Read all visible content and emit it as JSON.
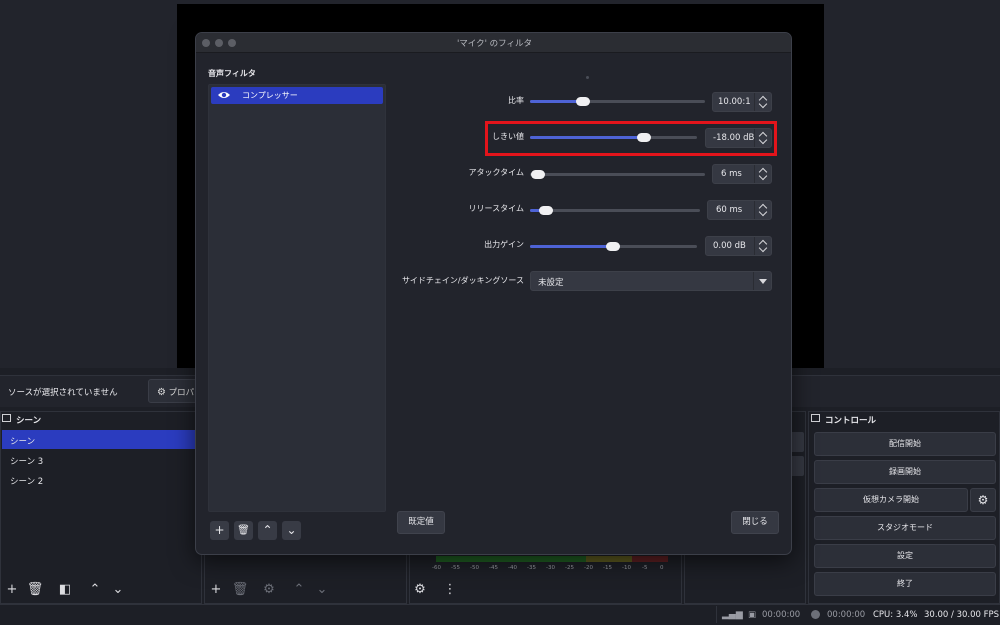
{
  "dialog": {
    "title": "'マイク' のフィルタ",
    "filters_label": "音声フィルタ",
    "filters": [
      {
        "label": "コンプレッサー",
        "icon": "eye-icon"
      }
    ],
    "default_button": "既定値",
    "close_button": "閉じる",
    "properties": {
      "ratio": {
        "label": "比率",
        "value": "10.00:1",
        "fill": 0.32
      },
      "threshold": {
        "label": "しきい値",
        "value": "-18.00 dB",
        "fill": 0.7
      },
      "attack": {
        "label": "アタックタイム",
        "value": "6 ms",
        "fill": 0.03
      },
      "release": {
        "label": "リリースタイム",
        "value": "60 ms",
        "fill": 0.1
      },
      "output_gain": {
        "label": "出力ゲイン",
        "value": "0.00 dB",
        "fill": 0.5
      },
      "sidechain": {
        "label": "サイドチェイン/ダッキングソース",
        "value": "未設定"
      }
    }
  },
  "source_bar": {
    "no_source": "ソースが選択されていません",
    "properties_button": "プロパ"
  },
  "scenes": {
    "title": "シーン",
    "items": [
      {
        "label": "シーン",
        "active": true
      },
      {
        "label": "シーン 3",
        "active": false
      },
      {
        "label": "シーン 2",
        "active": false
      }
    ]
  },
  "mixer": {
    "ticks": [
      "-60",
      "-55",
      "-50",
      "-45",
      "-40",
      "-35",
      "-30",
      "-25",
      "-20",
      "-15",
      "-10",
      "-5",
      "0"
    ]
  },
  "controls": {
    "title": "コントロール",
    "buttons": [
      "配信開始",
      "録画開始",
      "仮想カメラ開始",
      "スタジオモード",
      "設定",
      "終了"
    ]
  },
  "status": {
    "stream_time": "00:00:00",
    "record_time": "00:00:00",
    "cpu": "CPU: 3.4%",
    "fps": "30.00 / 30.00 FPS"
  },
  "colors": {
    "accent": "#2b3cbf",
    "highlight": "#e3141b",
    "slider_fill": "#4e63d6"
  }
}
